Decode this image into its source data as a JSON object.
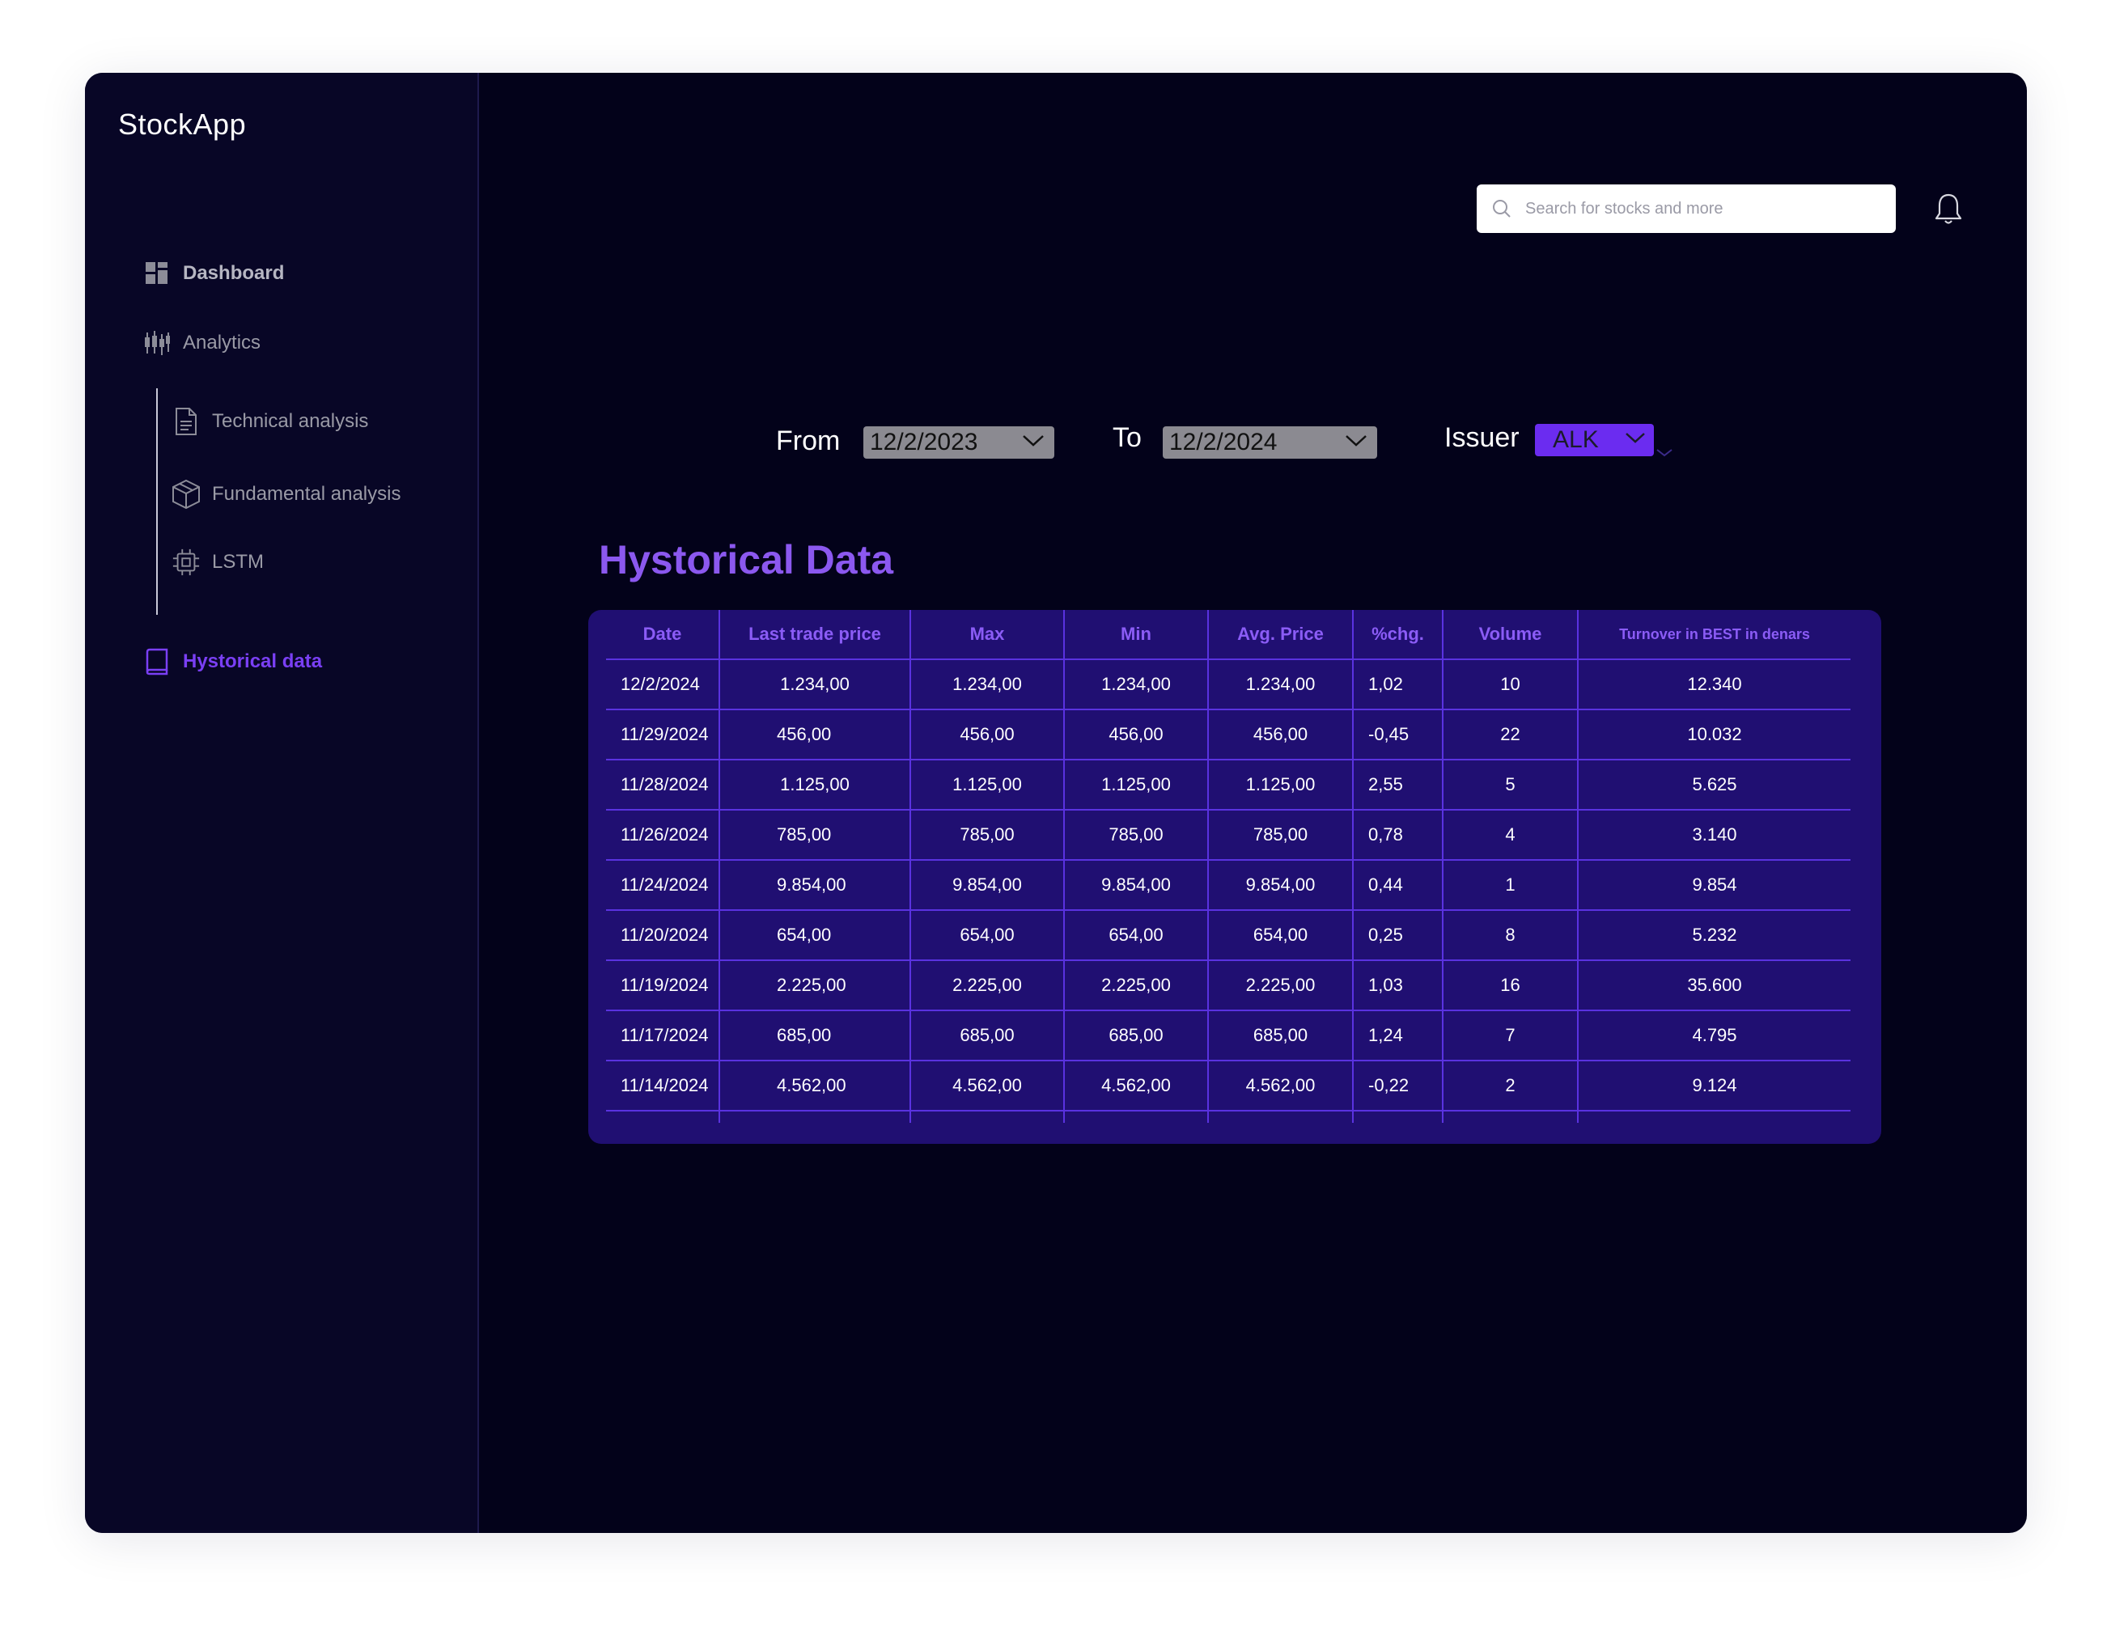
{
  "app": {
    "name": "StockApp"
  },
  "sidebar": {
    "items": [
      {
        "label": "Dashboard",
        "icon": "dashboard-icon"
      },
      {
        "label": "Analytics",
        "icon": "candlestick-icon"
      },
      {
        "label": "Technical analysis",
        "icon": "document-icon"
      },
      {
        "label": "Fundamental analysis",
        "icon": "cube-icon"
      },
      {
        "label": "LSTM",
        "icon": "chip-icon"
      },
      {
        "label": "Hystorical data",
        "icon": "book-icon",
        "active": true
      }
    ]
  },
  "header": {
    "search_placeholder": "Search for stocks and more",
    "icons": [
      "search-icon",
      "bell-icon"
    ]
  },
  "filters": {
    "from_label": "From",
    "from_value": "12/2/2023",
    "to_label": "To",
    "to_value": "12/2/2024",
    "issuer_label": "Issuer",
    "issuer_value": "ALK"
  },
  "main": {
    "title": "Hystorical Data"
  },
  "colors": {
    "background": "#03021a",
    "sidebar": "#080626",
    "accent": "#6b2cf0",
    "title": "#8b58ef",
    "table_bg": "#200f72",
    "table_lines": "#5a32e0"
  },
  "table": {
    "columns": [
      "Date",
      "Last trade price",
      "Max",
      "Min",
      "Avg. Price",
      "%chg.",
      "Volume",
      "Turnover in BEST in denars"
    ],
    "rows": [
      [
        "12/2/2024",
        "1.234,00",
        "1.234,00",
        "1.234,00",
        "1.234,00",
        "1,02",
        "10",
        "12.340"
      ],
      [
        "11/29/2024",
        "456,00",
        "456,00",
        "456,00",
        "456,00",
        "-0,45",
        "22",
        "10.032"
      ],
      [
        "11/28/2024",
        "1.125,00",
        "1.125,00",
        "1.125,00",
        "1.125,00",
        "2,55",
        "5",
        "5.625"
      ],
      [
        "11/26/2024",
        "785,00",
        "785,00",
        "785,00",
        "785,00",
        "0,78",
        "4",
        "3.140"
      ],
      [
        "11/24/2024",
        "9.854,00",
        "9.854,00",
        "9.854,00",
        "9.854,00",
        "0,44",
        "1",
        "9.854"
      ],
      [
        "11/20/2024",
        "654,00",
        "654,00",
        "654,00",
        "654,00",
        "0,25",
        "8",
        "5.232"
      ],
      [
        "11/19/2024",
        "2.225,00",
        "2.225,00",
        "2.225,00",
        "2.225,00",
        "1,03",
        "16",
        "35.600"
      ],
      [
        "11/17/2024",
        "685,00",
        "685,00",
        "685,00",
        "685,00",
        "1,24",
        "7",
        "4.795"
      ],
      [
        "11/14/2024",
        "4.562,00",
        "4.562,00",
        "4.562,00",
        "4.562,00",
        "-0,22",
        "2",
        "9.124"
      ]
    ]
  }
}
